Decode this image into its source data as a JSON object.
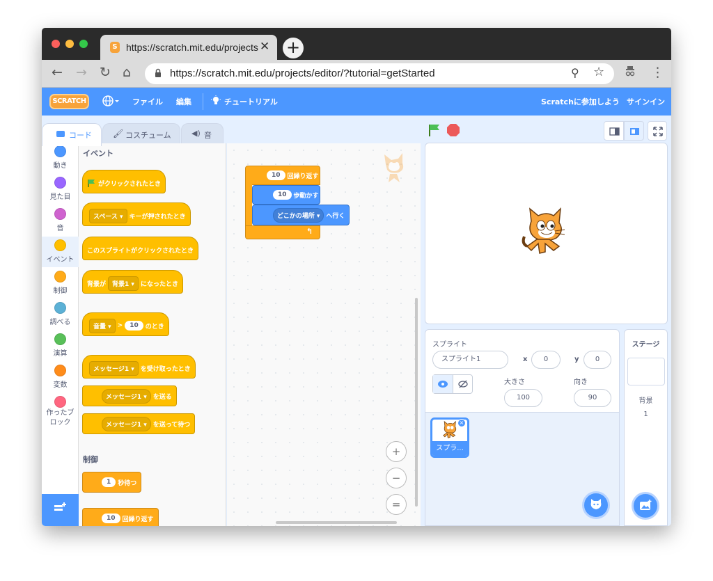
{
  "browser": {
    "tab_title": "https://scratch.mit.edu/projects/editor/?tutorial=getStarted",
    "url": "https://scratch.mit.edu/projects/editor/?tutorial=getStarted",
    "close_glyph": "✕",
    "newtab_glyph": "+",
    "back_glyph": "←",
    "forward_glyph": "→",
    "reload_glyph": "↻",
    "home_glyph": "⌂",
    "zoom_glyph": "⚲",
    "star_glyph": "☆",
    "more_glyph": "⋮"
  },
  "menubar": {
    "logo": "SCRATCH",
    "file": "ファイル",
    "edit": "編集",
    "tutorial": "チュートリアル",
    "join": "Scratchに参加しよう",
    "signin": "サインイン"
  },
  "editor_tabs": {
    "code": "コード",
    "costumes": "コスチューム",
    "sounds": "音"
  },
  "categories": [
    {
      "label": "動き",
      "color": "#4c97ff"
    },
    {
      "label": "見た目",
      "color": "#9966ff"
    },
    {
      "label": "音",
      "color": "#cf63cf"
    },
    {
      "label": "イベント",
      "color": "#ffbf00"
    },
    {
      "label": "制御",
      "color": "#ffab19"
    },
    {
      "label": "調べる",
      "color": "#5cb1d6"
    },
    {
      "label": "演算",
      "color": "#59c059"
    },
    {
      "label": "変数",
      "color": "#ff8c1a"
    },
    {
      "label": "作ったブ\nロック",
      "color": "#ff6680"
    }
  ],
  "palette": {
    "events_title": "イベント",
    "flag_clicked": "がクリックされたとき",
    "key_space": "スペース",
    "key_pressed": "キーが押されたとき",
    "sprite_clicked": "このスプライトがクリックされたとき",
    "backdrop_prefix": "背景が",
    "backdrop_value": "背景1",
    "backdrop_suffix": "になったとき",
    "volume_dd": "音量",
    "gt": ">",
    "volume_value": "10",
    "volume_suffix": "のとき",
    "message_dd": "メッセージ1",
    "receive_suffix": "を受け取ったとき",
    "send_suffix": "を送る",
    "send_wait_suffix": "を送って待つ",
    "control_title": "制御",
    "wait_value": "1",
    "wait_suffix": "秒待つ",
    "repeat_value": "10",
    "repeat_suffix": "回繰り返す"
  },
  "script": {
    "repeat_value": "10",
    "repeat_label": "回繰り返す",
    "move_value": "10",
    "move_label": "歩動かす",
    "goto_dd": "どこかの場所",
    "goto_suffix": "へ行く"
  },
  "zoom": {
    "zoom_in": "+",
    "zoom_out": "−",
    "reset": "="
  },
  "sprite_info": {
    "title": "スプライト",
    "name": "スプライト1",
    "x_label": "x",
    "x_value": "0",
    "y_label": "y",
    "y_value": "0",
    "size_label": "大きさ",
    "size_value": "100",
    "direction_label": "向き",
    "direction_value": "90",
    "thumb_label": "スプラ..."
  },
  "stage_panel": {
    "title": "ステージ",
    "backdrop_label": "背景",
    "backdrop_count": "1"
  }
}
